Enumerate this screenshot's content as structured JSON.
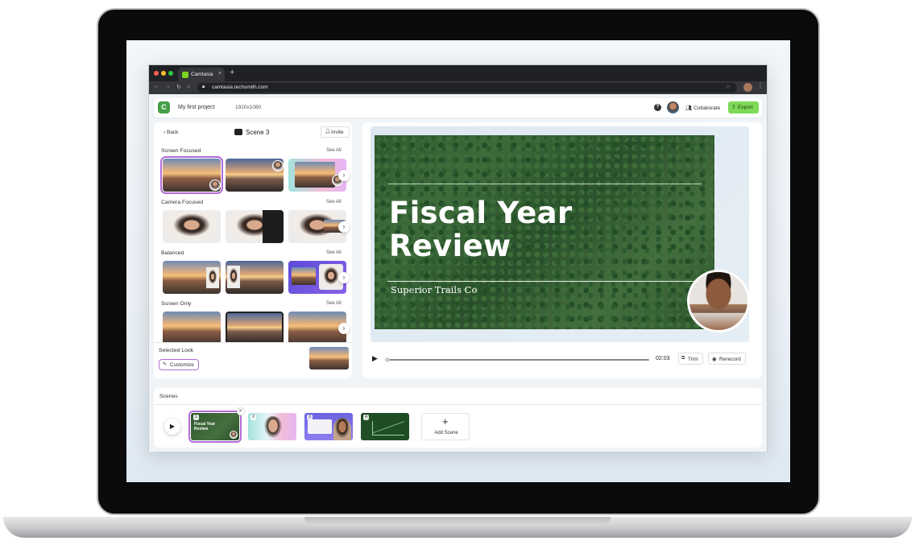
{
  "browser": {
    "tab_title": "Camtasia",
    "tab_close": "×",
    "new_tab": "+",
    "url": "camtasia.techsmith.com"
  },
  "app": {
    "project_name": "My first project",
    "resolution": "1920x1080",
    "help": "?",
    "collaborate_label": "Collaborate",
    "export_label": "Export"
  },
  "left_panel": {
    "back_label": "Back",
    "scene_title": "Scene 3",
    "invite_label": "Invite",
    "sections": [
      {
        "title": "Screen Focused",
        "see_all": "See All"
      },
      {
        "title": "Camera Focused",
        "see_all": "See All"
      },
      {
        "title": "Balanced",
        "see_all": "See All"
      },
      {
        "title": "Screen Only",
        "see_all": "See All"
      }
    ],
    "selected_look_label": "Selected Look",
    "customize_label": "Customize"
  },
  "preview": {
    "slide_title": "Fiscal Year Review",
    "slide_subtitle": "Superior Trails Co",
    "time": "02:03",
    "trim_label": "Trim",
    "rerecord_label": "Rerecord"
  },
  "scenes": {
    "title": "Scenes",
    "items": [
      {
        "number": "1",
        "mini_title": "Fiscal Year Review"
      },
      {
        "number": "2"
      },
      {
        "number": "3"
      },
      {
        "number": "4"
      }
    ],
    "add_scene_label": "Add Scene"
  },
  "colors": {
    "accent_purple": "#b36bd9",
    "export_green": "#7ed957",
    "brand_green": "#43a047"
  }
}
